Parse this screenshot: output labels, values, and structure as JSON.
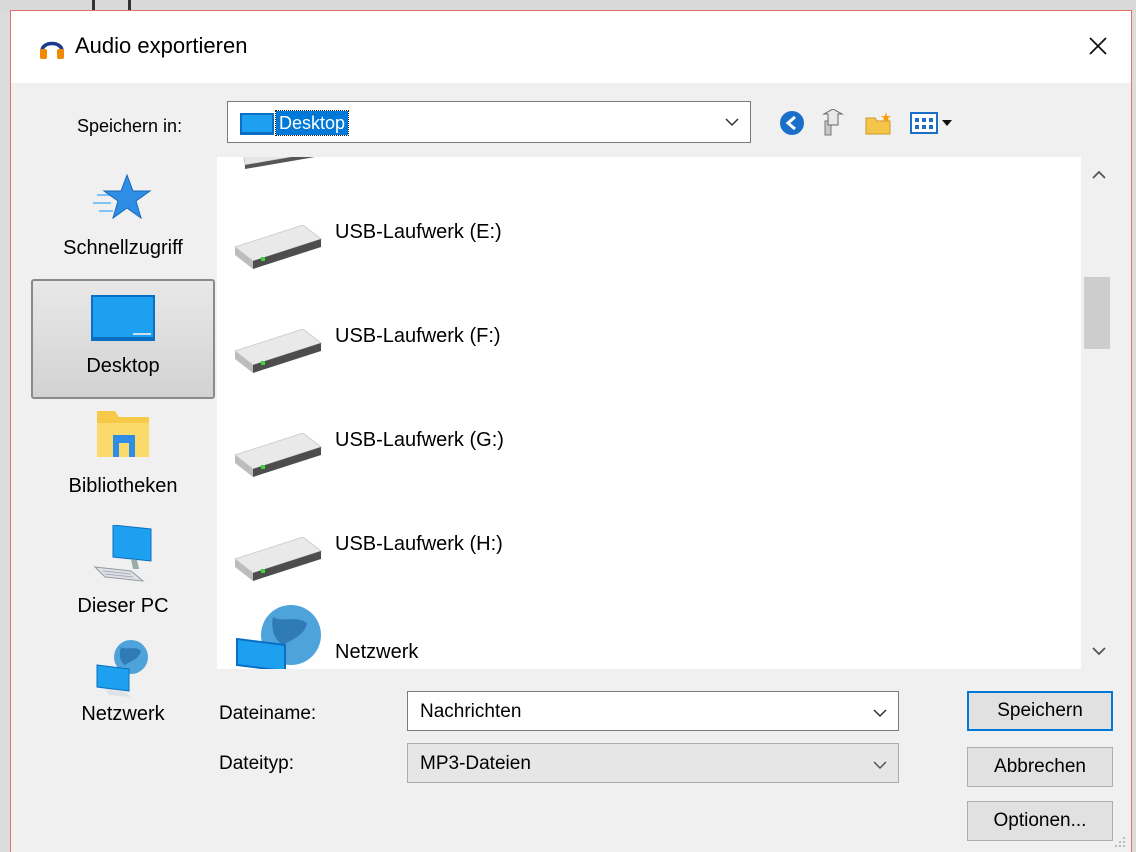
{
  "window": {
    "title": "Audio exportieren"
  },
  "toolbar": {
    "save_in_label": "Speichern in:",
    "location": "Desktop"
  },
  "places": [
    {
      "label": "Schnellzugriff",
      "icon": "star-icon",
      "selected": false
    },
    {
      "label": "Desktop",
      "icon": "desktop-icon",
      "selected": true
    },
    {
      "label": "Bibliotheken",
      "icon": "libraries-folder-icon",
      "selected": false
    },
    {
      "label": "Dieser PC",
      "icon": "computer-icon",
      "selected": false
    },
    {
      "label": "Netzwerk",
      "icon": "network-icon",
      "selected": false
    }
  ],
  "files": [
    {
      "label": "USB-Laufwerk (E:)",
      "icon": "drive-icon"
    },
    {
      "label": "USB-Laufwerk (F:)",
      "icon": "drive-icon"
    },
    {
      "label": "USB-Laufwerk (G:)",
      "icon": "drive-icon"
    },
    {
      "label": "USB-Laufwerk (H:)",
      "icon": "drive-icon"
    },
    {
      "label": "Netzwerk",
      "icon": "network-globe-icon"
    }
  ],
  "form": {
    "filename_label": "Dateiname:",
    "filename_value": "Nachrichten",
    "filetype_label": "Dateityp:",
    "filetype_value": "MP3-Dateien"
  },
  "buttons": {
    "save": "Speichern",
    "cancel": "Abbrechen",
    "options": "Optionen..."
  },
  "colors": {
    "accent": "#0078d7",
    "dialog_border": "#e0736e",
    "background": "#f0f0f0"
  }
}
